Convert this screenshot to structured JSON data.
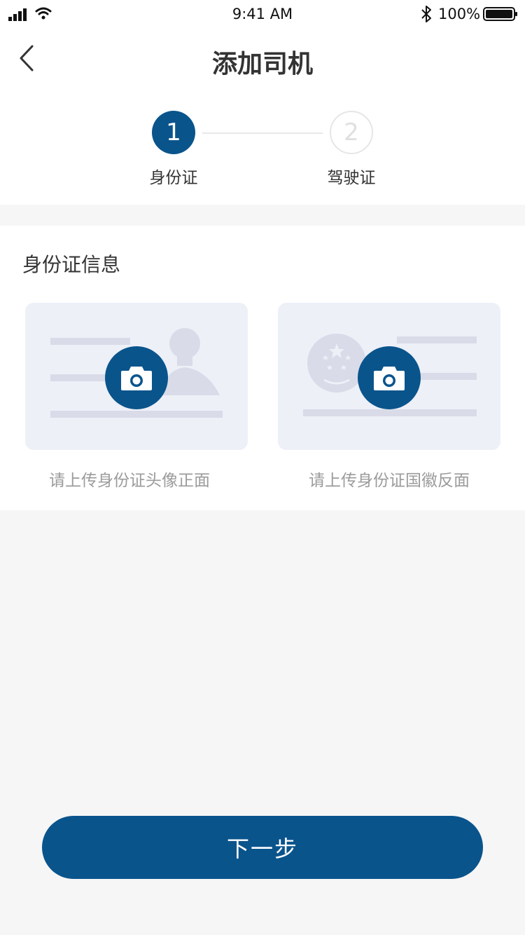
{
  "status_bar": {
    "time": "9:41 AM",
    "battery_percent": "100%",
    "signal_icon": "cellular-signal-icon",
    "wifi_icon": "wifi-icon",
    "bluetooth_icon": "bluetooth-icon",
    "battery_icon": "battery-full-icon"
  },
  "nav": {
    "title": "添加司机",
    "back_icon": "chevron-left-icon"
  },
  "stepper": {
    "steps": [
      {
        "number": "1",
        "label": "身份证",
        "active": true
      },
      {
        "number": "2",
        "label": "驾驶证",
        "active": false
      }
    ]
  },
  "id_section": {
    "title": "身份证信息",
    "uploads": [
      {
        "caption": "请上传身份证头像正面",
        "icon": "camera-icon",
        "art": "id-card-portrait-placeholder"
      },
      {
        "caption": "请上传身份证国徽反面",
        "icon": "camera-icon",
        "art": "id-card-emblem-placeholder"
      }
    ]
  },
  "footer": {
    "next_label": "下一步"
  },
  "colors": {
    "primary": "#0a548c",
    "card_bg": "#edf0f7",
    "page_bg": "#f6f6f6",
    "placeholder_shape": "#d9dce8",
    "caption": "#9b9b9b"
  }
}
